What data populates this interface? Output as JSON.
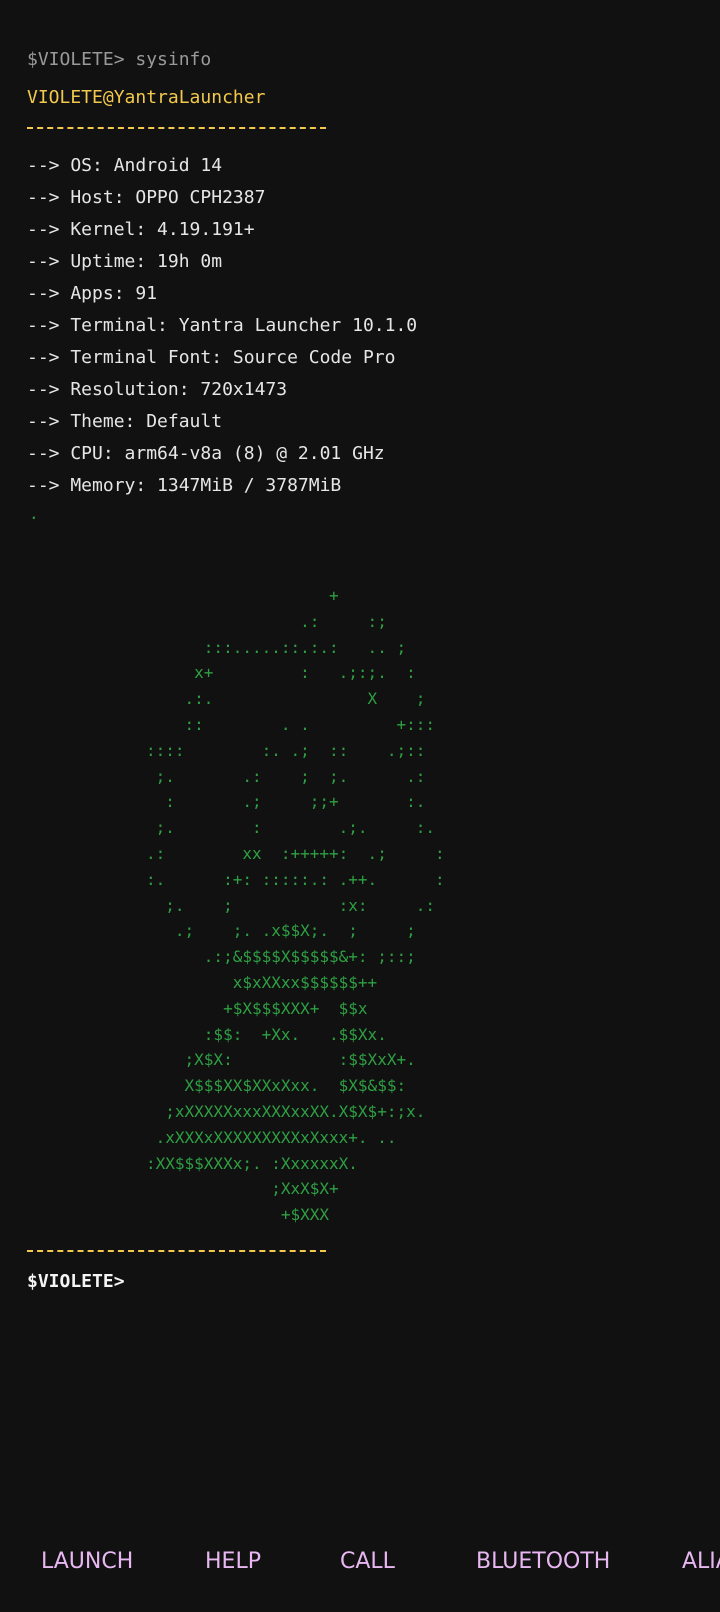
{
  "terminal": {
    "previous_command": "$VIOLETE> sysinfo",
    "user_host": "VIOLETE@YantraLauncher",
    "info_lines": [
      "--> OS: Android 14",
      "--> Host: OPPO CPH2387",
      "--> Kernel: 4.19.191+",
      "--> Uptime: 19h 0m",
      "--> Apps: 91",
      "--> Terminal: Yantra Launcher 10.1.0",
      "--> Terminal Font: Source Code Pro",
      "--> Resolution: 720x1473",
      "--> Theme: Default",
      "--> CPU: arm64-v8a (8) @ 2.01 GHz",
      "--> Memory: 1347MiB / 3787MiB"
    ],
    "dot": ".",
    "ascii_art": "                   +\n                .:     :;\n      :::.....::.:.:   .. ;\n     x+         :   .;:;.  :\n    .:.                X    ;\n    ::        . .         +:::\n::::        :. .;  ::    .;::\n ;.       .:    ;  ;.      .:\n  :       .;     ;;+       :.\n ;.        :        .;.     :.\n.:        xx  :+++++:  .;     :\n:.      :+: :::::.: .++.      :\n  ;.    ;           :x:     .:\n   .;    ;. .x$$X;.  ;     ;\n      .:;&$$$$X$$$$$&+: ;::;\n         x$xXXxx$$$$$$++\n        +$X$$$XXX+  $$x\n      :$$:  +Xx.   .$$Xx.\n    ;X$X:           :$$XxX+.\n    X$$$XX$XXxXxx.  $X$&$$:\n  ;xXXXXXxxxXXXxxXX.X$X$+:;x.\n .xXXXxXXXXXXXXXxXxxx+. ..\n:XX$$$XXXx;. :XxxxxxX.\n             ;XxX$X+\n              +$XXX",
    "prompt": "$VIOLETE>"
  },
  "bottom_bar": {
    "items": [
      {
        "label": "LAUNCH"
      },
      {
        "label": "HELP"
      },
      {
        "label": "CALL"
      },
      {
        "label": "BLUETOOTH"
      },
      {
        "label": "ALIAS"
      }
    ]
  },
  "colors": {
    "background": "#111111",
    "user_host": "#f2c94c",
    "separator": "#f2c94c",
    "info_text": "#e6e6e6",
    "ascii_art": "#2ea043",
    "prompt": "#f5f5f5",
    "bottom_bar_text": "#e8b7f2"
  }
}
